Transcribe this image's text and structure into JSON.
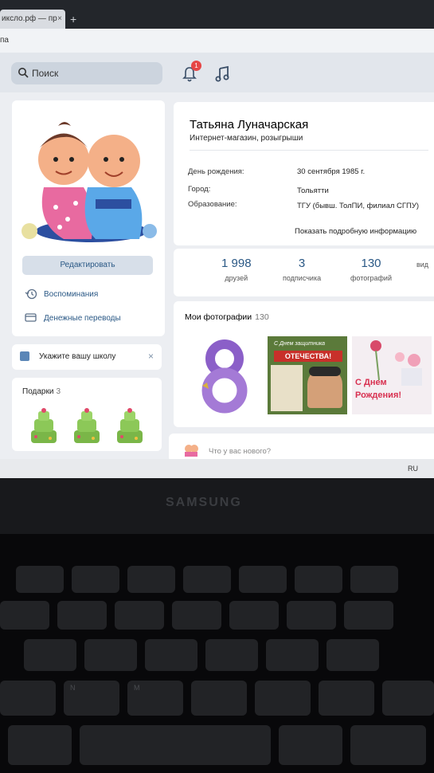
{
  "browser": {
    "tab_title": "иксло.рф — пр",
    "tab_close": "×",
    "new_tab": "+",
    "url_text": "па"
  },
  "header": {
    "search_placeholder": "Поиск",
    "notifications_badge": "1"
  },
  "profile": {
    "name": "Татьяна Луначарская",
    "status": "Интернет-магазин, розыгрыши",
    "info": [
      {
        "label": "День рождения:",
        "value": "30 сентября 1985 г."
      },
      {
        "label": "Город:",
        "value": "Тольятти"
      },
      {
        "label": "Образование:",
        "value": "ТГУ (бывш. ТолПИ, филиал СГПУ)"
      }
    ],
    "more_info": "Показать подробную информацию"
  },
  "sidebar": {
    "edit_button": "Редактировать",
    "items": [
      {
        "label": "Воспоминания",
        "icon": "clock-back-icon"
      },
      {
        "label": "Денежные переводы",
        "icon": "card-transfer-icon"
      }
    ]
  },
  "stats": [
    {
      "number": "1 998",
      "label": "друзей"
    },
    {
      "number": "3",
      "label": "подписчика"
    },
    {
      "number": "130",
      "label": "фотографий"
    },
    {
      "number": "",
      "label": "вид"
    }
  ],
  "photos": {
    "title": "Мои фотографии",
    "count": "130",
    "photo2_top": "С Днем защитника",
    "photo2_banner": "ОТЕЧЕСТВА!",
    "photo3_text": "С Днем Рождения!"
  },
  "school": {
    "text": "Укажите вашу школу",
    "close": "×"
  },
  "gifts": {
    "title": "Подарки",
    "count": "3"
  },
  "post": {
    "placeholder": "Что у вас нового?"
  },
  "taskbar": {
    "lang": "RU"
  },
  "laptop": {
    "brand": "SAMSUNG"
  },
  "keyboard": {
    "keys": [
      "N",
      "M"
    ]
  },
  "colors": {
    "link": "#2a5885",
    "accent": "#5b86b7",
    "badge": "#e64646"
  }
}
